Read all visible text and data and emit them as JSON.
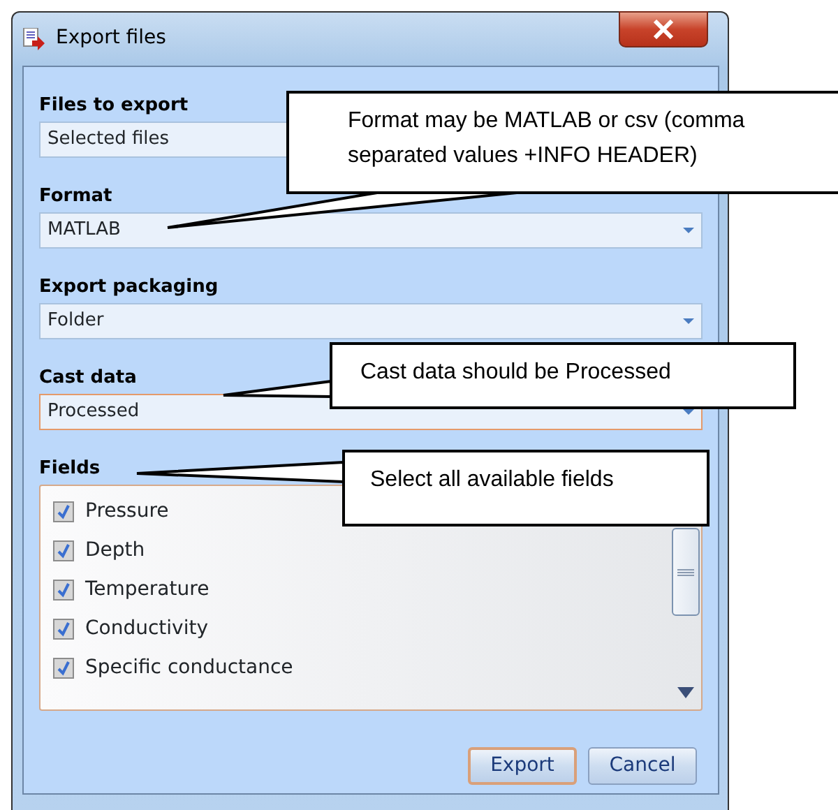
{
  "window": {
    "title": "Export files"
  },
  "sections": [
    {
      "label": "Files to export",
      "kind": "readonly",
      "value": "Selected files",
      "focused": false
    },
    {
      "label": "Format",
      "kind": "combo",
      "value": "MATLAB",
      "focused": false
    },
    {
      "label": "Export packaging",
      "kind": "combo",
      "value": "Folder",
      "focused": false
    },
    {
      "label": "Cast data",
      "kind": "combo",
      "value": "Processed",
      "focused": true
    },
    {
      "label": "Fields",
      "kind": "checklist",
      "items": [
        {
          "label": "Pressure",
          "checked": true
        },
        {
          "label": "Depth",
          "checked": true
        },
        {
          "label": "Temperature",
          "checked": true
        },
        {
          "label": "Conductivity",
          "checked": true
        },
        {
          "label": "Specific conductance",
          "checked": true
        }
      ]
    }
  ],
  "buttons": [
    {
      "label": "Export",
      "default": true
    },
    {
      "label": "Cancel",
      "default": false
    }
  ],
  "callouts": [
    {
      "text": "Format may be MATLAB or csv (comma separated values +INFO HEADER)"
    },
    {
      "text": "Cast data should be Processed"
    },
    {
      "text": "Select  all available fields"
    }
  ]
}
